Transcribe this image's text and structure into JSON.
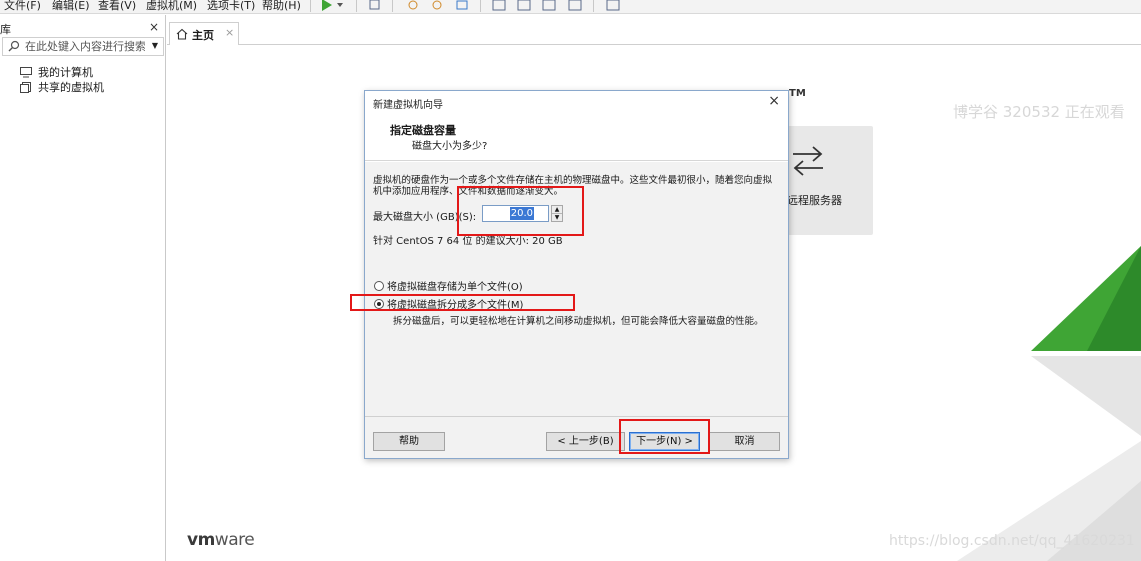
{
  "menubar": {
    "items": [
      "文件(F)",
      "编辑(E)",
      "查看(V)",
      "虚拟机(M)",
      "选项卡(T)",
      "帮助(H)"
    ],
    "play_icon": "play-icon",
    "accent": "#3fa535"
  },
  "library": {
    "title": "库",
    "close_glyph": "×",
    "search_placeholder": "在此处键入内容进行搜索",
    "tree": [
      "我的计算机",
      "共享的虚拟机"
    ]
  },
  "tabs": {
    "home_label": "主页",
    "home_close": "×"
  },
  "home": {
    "tm_mark": "TM",
    "remote_label": "远程服务器",
    "logo_vm": "vm",
    "logo_ware": "ware",
    "watermark_top": "博学谷 320532 正在观看",
    "watermark_bottom": "https://blog.csdn.net/qq_41620231"
  },
  "dialog": {
    "title": "新建虚拟机向导",
    "close_glyph": "×",
    "header_title": "指定磁盘容量",
    "header_subtitle": "磁盘大小为多少?",
    "description": "虚拟机的硬盘作为一个或多个文件存储在主机的物理磁盘中。这些文件最初很小，随着您向虚拟机中添加应用程序、文件和数据而逐渐变大。",
    "max_size_label": "最大磁盘大小 (GB)(S):",
    "max_size_value": "20.0",
    "recommend_text": "针对 CentOS 7 64 位 的建议大小: 20 GB",
    "radio_single": "将虚拟磁盘存储为单个文件(O)",
    "radio_split": "将虚拟磁盘拆分成多个文件(M)",
    "radio_selected": "split",
    "split_description": "拆分磁盘后，可以更轻松地在计算机之间移动虚拟机，但可能会降低大容量磁盘的性能。",
    "buttons": {
      "help": "帮助",
      "back": "< 上一步(B)",
      "next": "下一步(N) >",
      "cancel": "取消"
    }
  },
  "colors": {
    "annotation": "#e31818",
    "selection": "#3b78d4",
    "vm_green": "#3fa535"
  }
}
